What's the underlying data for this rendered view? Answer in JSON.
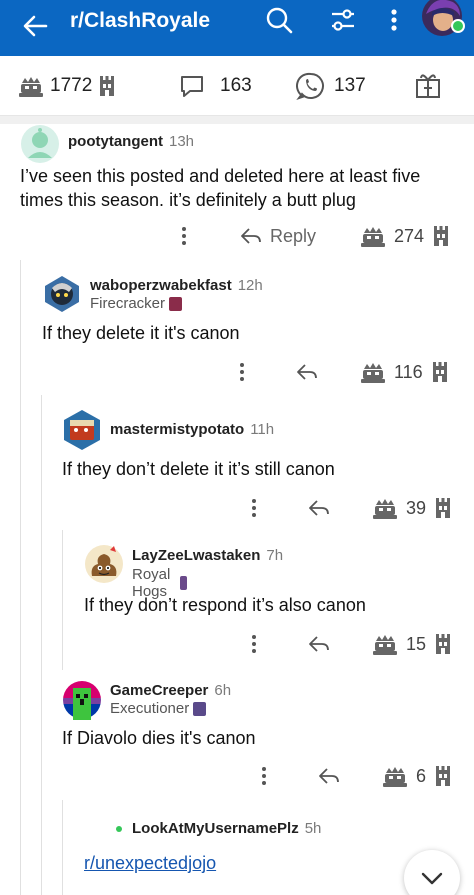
{
  "appbar": {
    "title": "r/ClashRoyale",
    "color": "#0b67c2",
    "icons": [
      "back-arrow-icon",
      "search-icon",
      "filter-icon",
      "more-vert-icon",
      "avatar"
    ]
  },
  "postbar": {
    "upvotes": "1772",
    "comments": "163",
    "shares": "137"
  },
  "comments": [
    {
      "username": "pootytangent",
      "age": "13h",
      "text": "I’ve seen this posted and deleted here at least five times this season. it’s definitely a butt plug",
      "reply_label": "Reply",
      "votes": "274"
    },
    {
      "username": "waboperzwabekfast",
      "age": "12h",
      "flair": "Firecracker",
      "text": "If they delete it it's canon",
      "votes": "116"
    },
    {
      "username": "mastermistypotato",
      "age": "11h",
      "text": "If they don’t delete it it’s still canon",
      "votes": "39"
    },
    {
      "username": "LayZeeLwastaken",
      "age": "7h",
      "flair": "Royal Hogs",
      "text": "If they don’t respond it’s also canon",
      "votes": "15"
    },
    {
      "username": "GameCreeper",
      "age": "6h",
      "flair": "Executioner",
      "text": "If Diavolo dies it's canon",
      "votes": "6"
    },
    {
      "username": "LookAtMyUsernamePlz",
      "age": "5h",
      "link": "r/unexpectedjojo"
    }
  ]
}
